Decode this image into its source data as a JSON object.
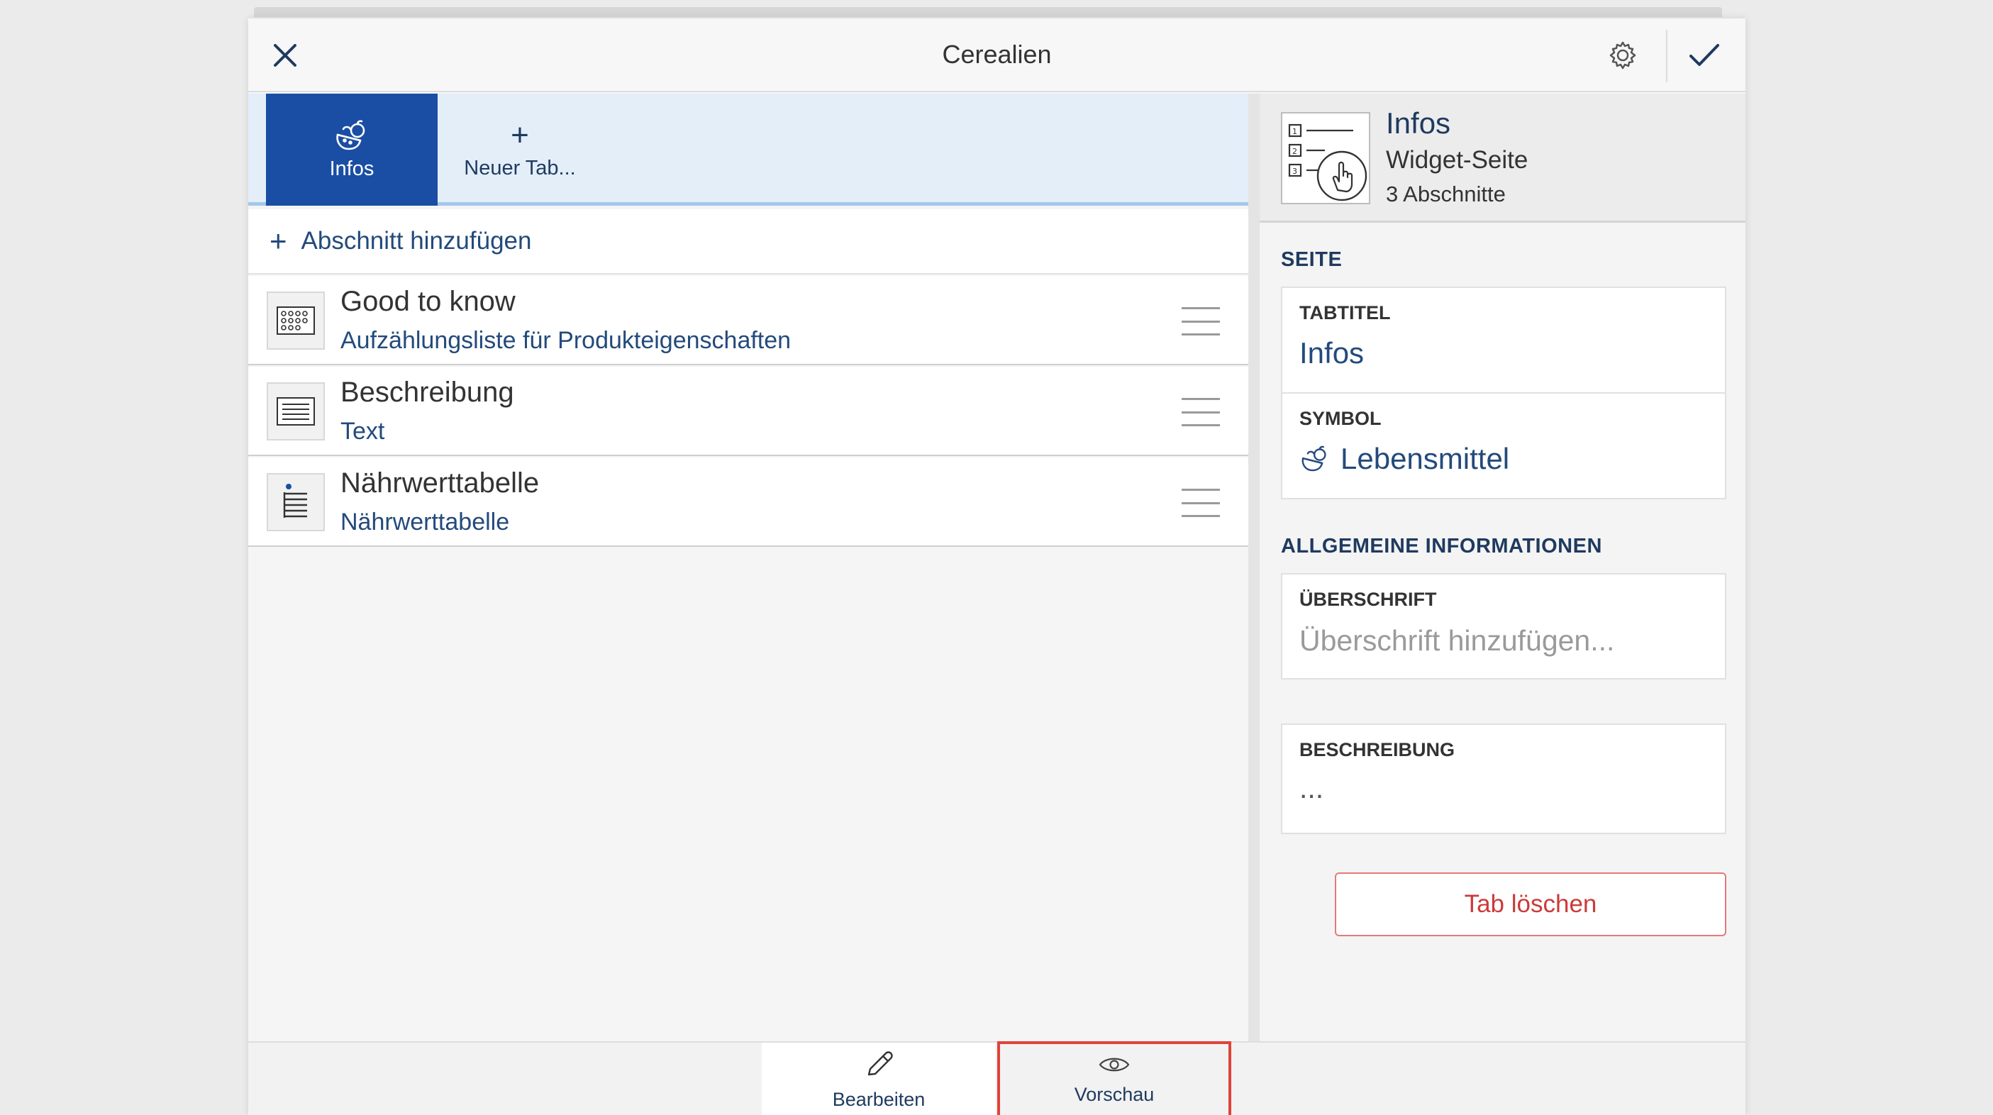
{
  "header": {
    "title": "Cerealien",
    "close_icon": "close-icon",
    "settings_icon": "gear-icon",
    "confirm_icon": "checkmark-icon"
  },
  "tabs": [
    {
      "label": "Infos",
      "icon": "food-icon",
      "active": true
    },
    {
      "label": "Neuer Tab...",
      "icon": "plus-icon",
      "active": false
    }
  ],
  "add_section": {
    "label": "Abschnitt hinzufügen"
  },
  "sections": [
    {
      "title": "Good to know",
      "subtitle": "Aufzählungsliste für Produkteigenschaften",
      "icon": "grid-list-icon"
    },
    {
      "title": "Beschreibung",
      "subtitle": "Text",
      "icon": "text-block-icon"
    },
    {
      "title": "Nährwerttabelle",
      "subtitle": "Nährwerttabelle",
      "icon": "nutrition-table-icon"
    }
  ],
  "info": {
    "title": "Infos",
    "type": "Widget-Seite",
    "count": "3 Abschnitte",
    "icon": "widget-page-icon"
  },
  "page_section": {
    "heading": "SEITE",
    "tab_title_label": "TABTITEL",
    "tab_title_value": "Infos",
    "symbol_label": "SYMBOL",
    "symbol_value": "Lebensmittel"
  },
  "general_section": {
    "heading": "ALLGEMEINE INFORMATIONEN",
    "heading_label": "ÜBERSCHRIFT",
    "heading_placeholder": "Überschrift hinzufügen...",
    "description_label": "BESCHREIBUNG",
    "description_value": "..."
  },
  "delete_button": {
    "label": "Tab löschen"
  },
  "bottom_bar": {
    "edit_label": "Bearbeiten",
    "preview_label": "Vorschau"
  },
  "colors": {
    "accent_blue": "#1a4ea4",
    "tabbar_bg": "#e3eef9",
    "delete_red": "#cc3a3a",
    "highlight_red": "#e0433a"
  }
}
